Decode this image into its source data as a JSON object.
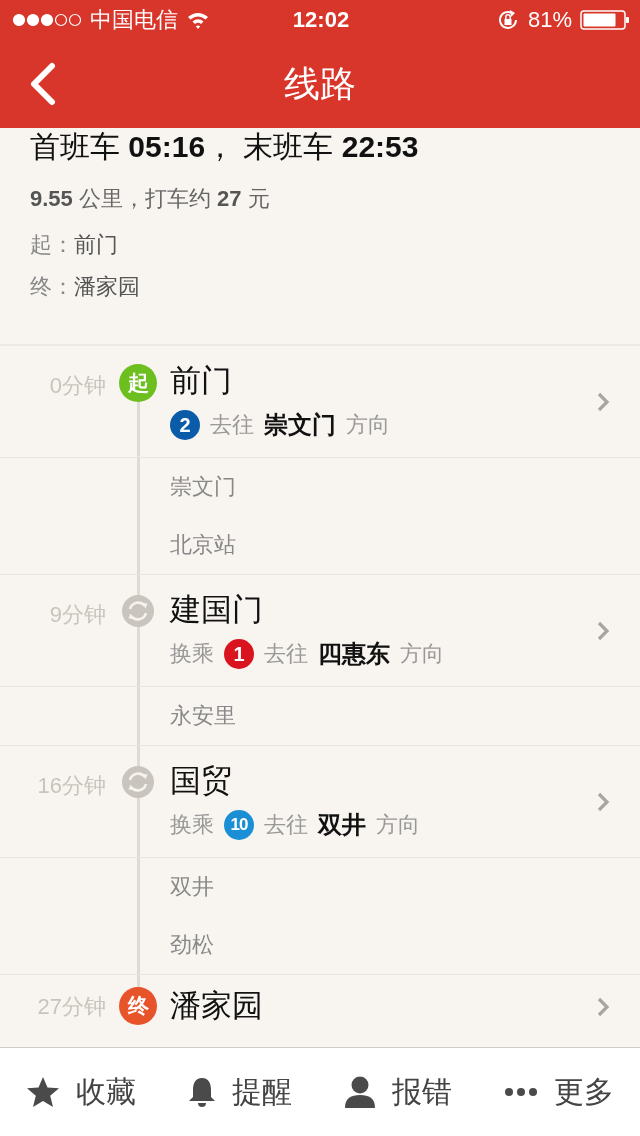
{
  "status_bar": {
    "carrier": "中国电信",
    "time": "12:02",
    "battery": "81%"
  },
  "nav": {
    "title": "线路"
  },
  "summary": {
    "schedule": "首班车 **05:16**，  末班车 **22:53**",
    "distance": "**9.55** 公里，打车约 **27** 元",
    "start_label": "起：",
    "start": "前门",
    "end_label": "终：",
    "end": "潘家园"
  },
  "route": [
    {
      "kind": "stop",
      "time": "0分钟",
      "marker": {
        "kind": "start",
        "text": "起"
      },
      "name": "前门",
      "line": {
        "number": "2",
        "color": "#0a5ca8"
      },
      "to": "去往",
      "direction": "崇文门",
      "direction_suffix": "方向"
    },
    {
      "kind": "pass",
      "name": "崇文门"
    },
    {
      "kind": "pass",
      "name": "北京站"
    },
    {
      "kind": "stop",
      "time": "9分钟",
      "marker": {
        "kind": "transfer"
      },
      "name": "建国门",
      "transfer": "换乘",
      "line": {
        "number": "1",
        "color": "#d9141f"
      },
      "to": "去往",
      "direction": "四惠东",
      "direction_suffix": "方向"
    },
    {
      "kind": "pass",
      "name": "永安里"
    },
    {
      "kind": "stop",
      "time": "16分钟",
      "marker": {
        "kind": "transfer"
      },
      "name": "国贸",
      "transfer": "换乘",
      "line": {
        "number": "10",
        "color": "#1a8fd6"
      },
      "to": "去往",
      "direction": "双井",
      "direction_suffix": "方向"
    },
    {
      "kind": "pass",
      "name": "双井"
    },
    {
      "kind": "pass",
      "name": "劲松"
    },
    {
      "kind": "stop",
      "time": "27分钟",
      "marker": {
        "kind": "end",
        "text": "终"
      },
      "name": "潘家园"
    }
  ],
  "toolbar": [
    {
      "kind": "star",
      "label": "收藏"
    },
    {
      "kind": "bell",
      "label": "提醒"
    },
    {
      "kind": "person",
      "label": "报错"
    },
    {
      "kind": "more",
      "label": "更多"
    }
  ]
}
